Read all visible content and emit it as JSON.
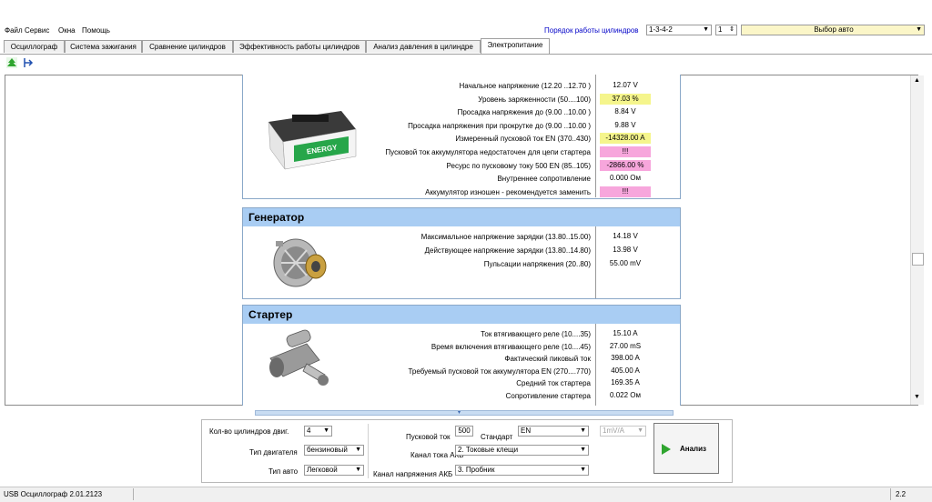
{
  "menu": [
    "Файл",
    "Сервис",
    "Окна",
    "Помощь"
  ],
  "firing_order": {
    "label": "Порядок работы цилиндров",
    "value": "1-3-4-2",
    "spin_value": "1"
  },
  "vehicle_select": {
    "value": "Выбор авто"
  },
  "tabs": [
    "Осциллограф",
    "Система зажигания",
    "Сравнение цилиндров",
    "Эффективность работы цилиндров",
    "Анализ давления в цилиндре",
    "Электропитание"
  ],
  "active_tab": "Электропитание",
  "battery": {
    "image_text": "ENERGY",
    "rows": [
      {
        "label": "Начальное напряжение (12.20 ..12.70 )",
        "value": "12.07 V",
        "hl": ""
      },
      {
        "label": "Уровень заряженности (50....100)",
        "value": "37.03 %",
        "hl": "yellow"
      },
      {
        "label": "Просадка напряжения до (9.00 ..10.00 )",
        "value": "8.84 V",
        "hl": ""
      },
      {
        "label": "Просадка напряжения при прокрутке до (9.00 ..10.00 )",
        "value": "9.88 V",
        "hl": ""
      },
      {
        "label": "Измеренный пусковой ток  EN (370..430)",
        "value": "-14328.00 A",
        "hl": "yellow"
      },
      {
        "label": "Пусковой ток аккумулятора недостаточен для цепи стартера",
        "value": "!!!",
        "hl": "pink"
      },
      {
        "label": "Ресурс по пусковому току  500 EN (85..105)",
        "value": "-2866.00 %",
        "hl": "pink"
      },
      {
        "label": "Внутреннее сопротивление",
        "value": "0.000 Ом",
        "hl": ""
      },
      {
        "label": "Аккумулятор изношен - рекомендуется заменить",
        "value": "!!!",
        "hl": "pink"
      }
    ]
  },
  "generator": {
    "title": "Генератор",
    "rows": [
      {
        "label": "Максимальное напряжение зарядки  (13.80..15.00)",
        "value": "14.18 V"
      },
      {
        "label": "Действующее напряжение зарядки (13.80..14.80)",
        "value": "13.98 V"
      },
      {
        "label": "Пульсации напряжения (20..80)",
        "value": "55.00 mV"
      }
    ]
  },
  "starter": {
    "title": "Стартер",
    "rows": [
      {
        "label": "Ток втягивающего реле (10....35)",
        "value": "15.10 A"
      },
      {
        "label": "Время включения втягивающего реле (10....45)",
        "value": "27.00 mS"
      },
      {
        "label": "Фактический пиковый ток",
        "value": "398.00 A"
      },
      {
        "label": "Требуемый пусковой ток аккумулятора  EN (270....770)",
        "value": "405.00 A"
      },
      {
        "label": "Средний ток стартера",
        "value": "169.35 A"
      },
      {
        "label": "Сопротивление стартера",
        "value": "0.022 Ом"
      }
    ]
  },
  "controls": {
    "cylinders_label": "Кол-во цилиндров двиг.",
    "cylinders_value": "4",
    "engine_label": "Тип двигателя",
    "engine_value": "бензиновый",
    "car_label": "Тип авто",
    "car_value": "Легковой",
    "start_current_label": "Пусковой ток",
    "start_current_value": "500",
    "standard_label": "Стандарт",
    "standard_value": "EN",
    "current_channel_label": "Канал тока АКБ",
    "current_channel_value": "2. Токовые клещи",
    "voltage_channel_label": "Канал напряжения АКБ",
    "voltage_channel_value": "3. Пробник",
    "scale_value": "1mV/A",
    "analyze_label": "Анализ"
  },
  "status": {
    "app": "USB Осциллограф  2.01.2123",
    "right": "2.2"
  },
  "colors": {
    "panel_header": "#a9cdf3",
    "warn_yellow": "#f5f58c",
    "warn_pink": "#f7a6dc",
    "play_green": "#2fa52f"
  }
}
